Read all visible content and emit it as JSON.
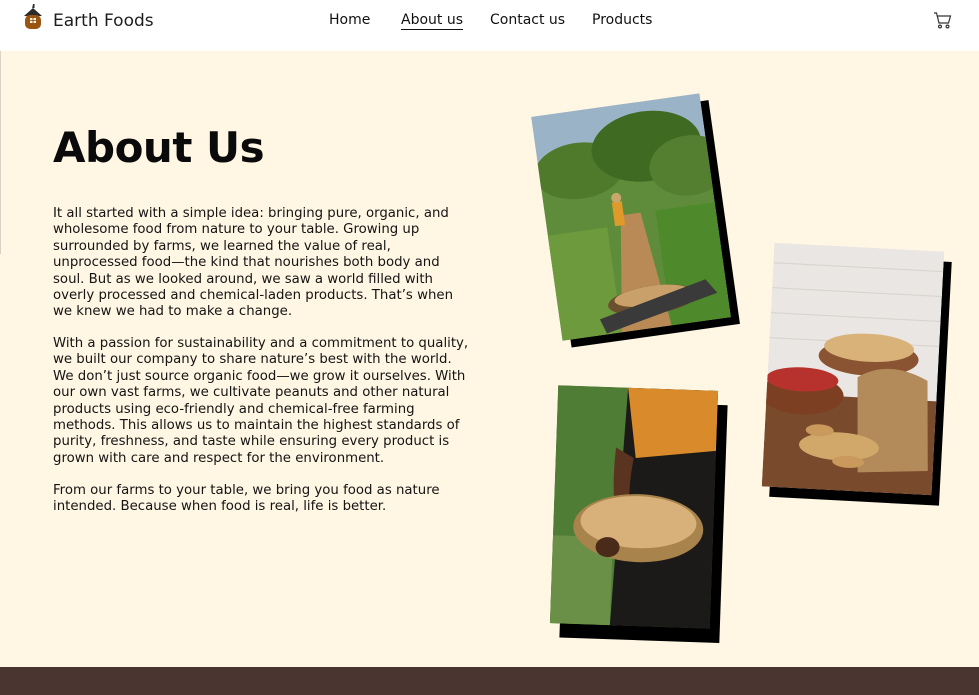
{
  "brand": {
    "name": "Earth Foods",
    "icon": "house-logo-icon"
  },
  "nav": {
    "items": [
      {
        "label": "Home"
      },
      {
        "label": "About us",
        "active": true
      },
      {
        "label": "Contact us"
      },
      {
        "label": "Products"
      }
    ]
  },
  "cart": {
    "icon": "cart-icon"
  },
  "about": {
    "title": "About Us",
    "paragraphs": [
      "It all started with a simple idea: bringing pure, organic, and wholesome food from nature to your table. Growing up surrounded by farms, we learned the value of real, unprocessed food—the kind that nourishes both body and soul. But as we looked around, we saw a world filled with overly processed and chemical-laden products. That’s when we knew we had to make a change.",
      "With a passion for sustainability and a commitment to quality, we built our company to share nature’s best with the world. We don’t just source organic food—we grow it ourselves. With our own vast farms, we cultivate peanuts and other natural products using eco-friendly and chemical-free farming methods. This allows us to maintain the highest standards of purity, freshness, and taste while ensuring every product is grown with care and respect for the environment.",
      "From our farms to your table, we bring you food as nature intended. Because when food is real, life is better."
    ]
  },
  "photos": [
    {
      "name": "farm-field-photo"
    },
    {
      "name": "peanuts-bowls-photo"
    },
    {
      "name": "peanut-basket-photo"
    }
  ],
  "colors": {
    "page_bg": "#fff6e3",
    "footer_bg": "#4b3531",
    "logo_brown": "#8a4a12"
  }
}
